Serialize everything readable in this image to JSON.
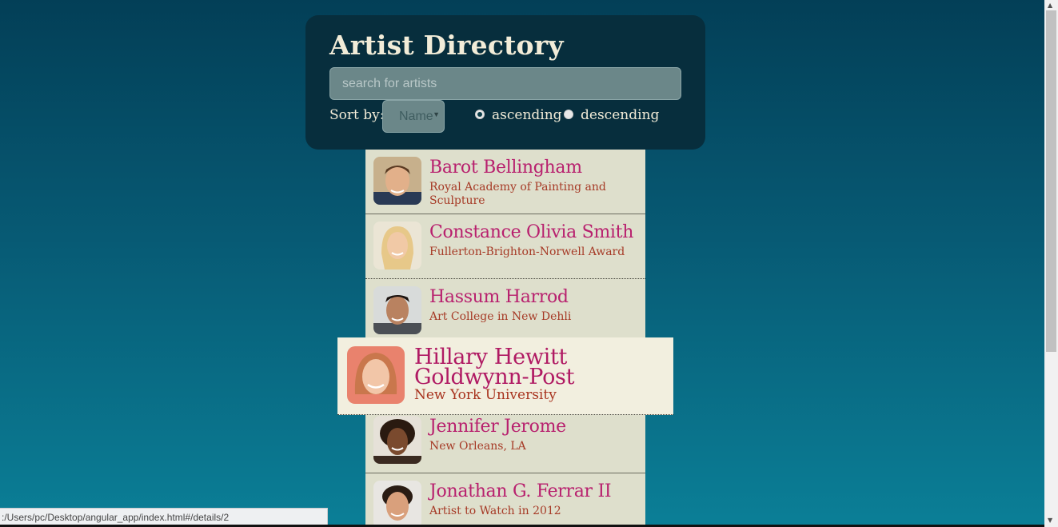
{
  "header": {
    "title": "Artist Directory",
    "search_placeholder": "search for artists",
    "sort_label": "Sort by:",
    "sort_value": "Name",
    "order_options": [
      "ascending",
      "descending"
    ],
    "order_selected": "ascending"
  },
  "artists": [
    {
      "name": "Barot Bellingham",
      "org": "Royal Academy of Painting and Sculpture"
    },
    {
      "name": "Constance Olivia Smith",
      "org": "Fullerton-Brighton-Norwell Award"
    },
    {
      "name": "Hassum Harrod",
      "org": "Art College in New Dehli"
    },
    {
      "name": "Hillary Hewitt Goldwynn-Post",
      "org": "New York University"
    },
    {
      "name": "Jennifer Jerome",
      "org": "New Orleans, LA"
    },
    {
      "name": "Jonathan G. Ferrar II",
      "org": "Artist to Watch in 2012"
    }
  ],
  "status_bar": {
    "url": ":/Users/pc/Desktop/angular_app/index.html#/details/2"
  },
  "colors": {
    "background_top": "#033f57",
    "background_bottom": "#0b7f97",
    "panel": "#072e3d",
    "name": "#b8206e",
    "org": "#a63a26",
    "list_bg": "#dedfcc"
  }
}
